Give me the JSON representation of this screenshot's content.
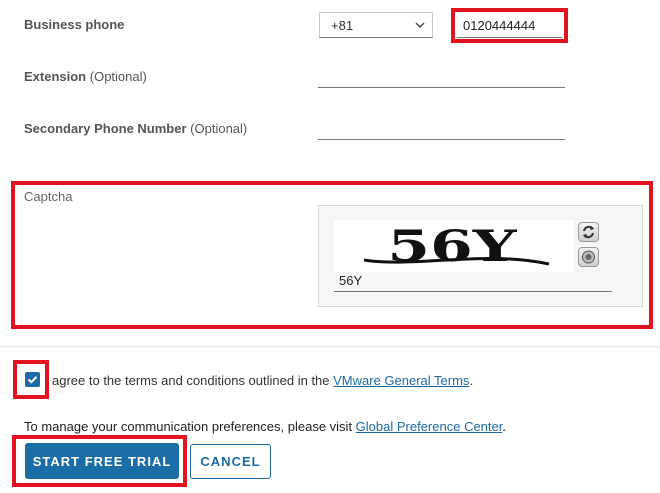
{
  "phone": {
    "label": "Business phone",
    "country_code": "+81",
    "number_value": "0120444444"
  },
  "extension": {
    "label": "Extension",
    "optional": "(Optional)",
    "value": ""
  },
  "secondary_phone": {
    "label": "Secondary Phone Number",
    "optional": "(Optional)",
    "value": ""
  },
  "captcha": {
    "label": "Captcha",
    "image_text": "56Y",
    "input_value": "56Y",
    "refresh_icon": "refresh-icon",
    "audio_icon": "audio-icon"
  },
  "agreement": {
    "checked": true,
    "text_before": "agree to the terms and conditions outlined in the ",
    "link_text": "VMware General Terms",
    "text_after": "."
  },
  "preferences": {
    "text_before": "To manage your communication preferences, please visit ",
    "link_text": "Global Preference Center",
    "text_after": "."
  },
  "buttons": {
    "start_trial": "START FREE TRIAL",
    "cancel": "CANCEL"
  },
  "colors": {
    "accent": "#1d6aa5",
    "highlight": "#e0131f"
  }
}
